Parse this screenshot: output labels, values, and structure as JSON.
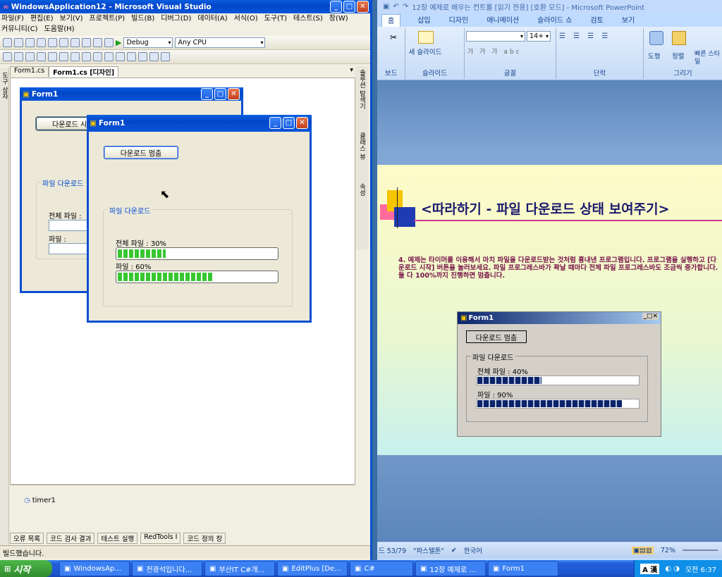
{
  "vs": {
    "title": "WindowsApplication12 - Microsoft Visual Studio",
    "menu": [
      "파일(F)",
      "편집(E)",
      "보기(V)",
      "프로젝트(P)",
      "빌드(B)",
      "디버그(D)",
      "데이터(A)",
      "서식(O)",
      "도구(T)",
      "테스트(S)",
      "창(W)",
      "커뮤니티(C)",
      "도움말(H)"
    ],
    "config": "Debug",
    "platform": "Any CPU",
    "tabs": [
      "Form1.cs",
      "Form1.cs [디자인]"
    ],
    "left_strip": "도구 상자",
    "right_strip": [
      "솔루션 탐색기",
      "클래스 뷰",
      "속성"
    ],
    "design_form": {
      "title": "Form1",
      "button": "다운로드 시",
      "group": "파일 다운로드",
      "label_total": "전체 파일 :",
      "label_file": "파일 :"
    },
    "timer": "timer1",
    "bottom_tabs": [
      "오류 목록",
      "코드 검사 결과",
      "테스트 실행",
      "RedTools I",
      "코드 정의 창"
    ],
    "status": "빌드했습니다."
  },
  "running_form": {
    "title": "Form1",
    "button": "다운로드 멈춤",
    "group": "파일 다운로드",
    "total_label": "전체 파일 : 30%",
    "file_label": "파일 : 60%",
    "total_value": 0.3,
    "file_value": 0.6
  },
  "ppt": {
    "title": "12장 예제로 배우는 컨트롤 [읽기 전용] [호환 모드] - Microsoft PowerPoint",
    "ribbon_tabs": [
      "홈",
      "삽입",
      "디자인",
      "애니메이션",
      "슬라이드 쇼",
      "검토",
      "보기"
    ],
    "groups": [
      "보드",
      "슬라이드",
      "글꼴",
      "단락",
      "그리기"
    ],
    "new_slide": "새 슬라이드",
    "font_size": "14+",
    "shape_btn": "도형",
    "arrange_btn": "정렬",
    "style_btn": "빠른 스타일",
    "slide_title": "<따라하기 - 파일 다운로드 상태 보여주기>",
    "slide_body": "4. 예제는 타이머를 이용해서 마치 파일을 다운로드받는 것처럼 흉내낸 프로그램입니다. 프로그램을 실행하고 [다운로드 시작] 버튼을 눌러보세요. 파일 프로그레스바가 꽉날 때마다 전체 파일 프로그레스바도 조금씩 증가합니다. 둘 다 100%까지 진행하면 멈춥니다.",
    "slide_form": {
      "title": "Form1",
      "button": "다운로드 멈춤",
      "group": "파일 다운로드",
      "total_label": "전체 파일 : 40%",
      "file_label": "파일 : 90%",
      "total_value": 0.4,
      "file_value": 0.9
    },
    "status_slide": "드 53/79",
    "status_theme": "\"파스텔톤\"",
    "status_lang": "한국어",
    "zoom": "72%"
  },
  "taskbar": {
    "start": "시작",
    "items": [
      "WindowsAp...",
      "전광석입니다...",
      "부산IT C#개...",
      "EditPlus [De...",
      "C#",
      "12장 예제로 ...",
      "Form1"
    ],
    "ime": "A 漢",
    "clock": "오전 6:37"
  }
}
